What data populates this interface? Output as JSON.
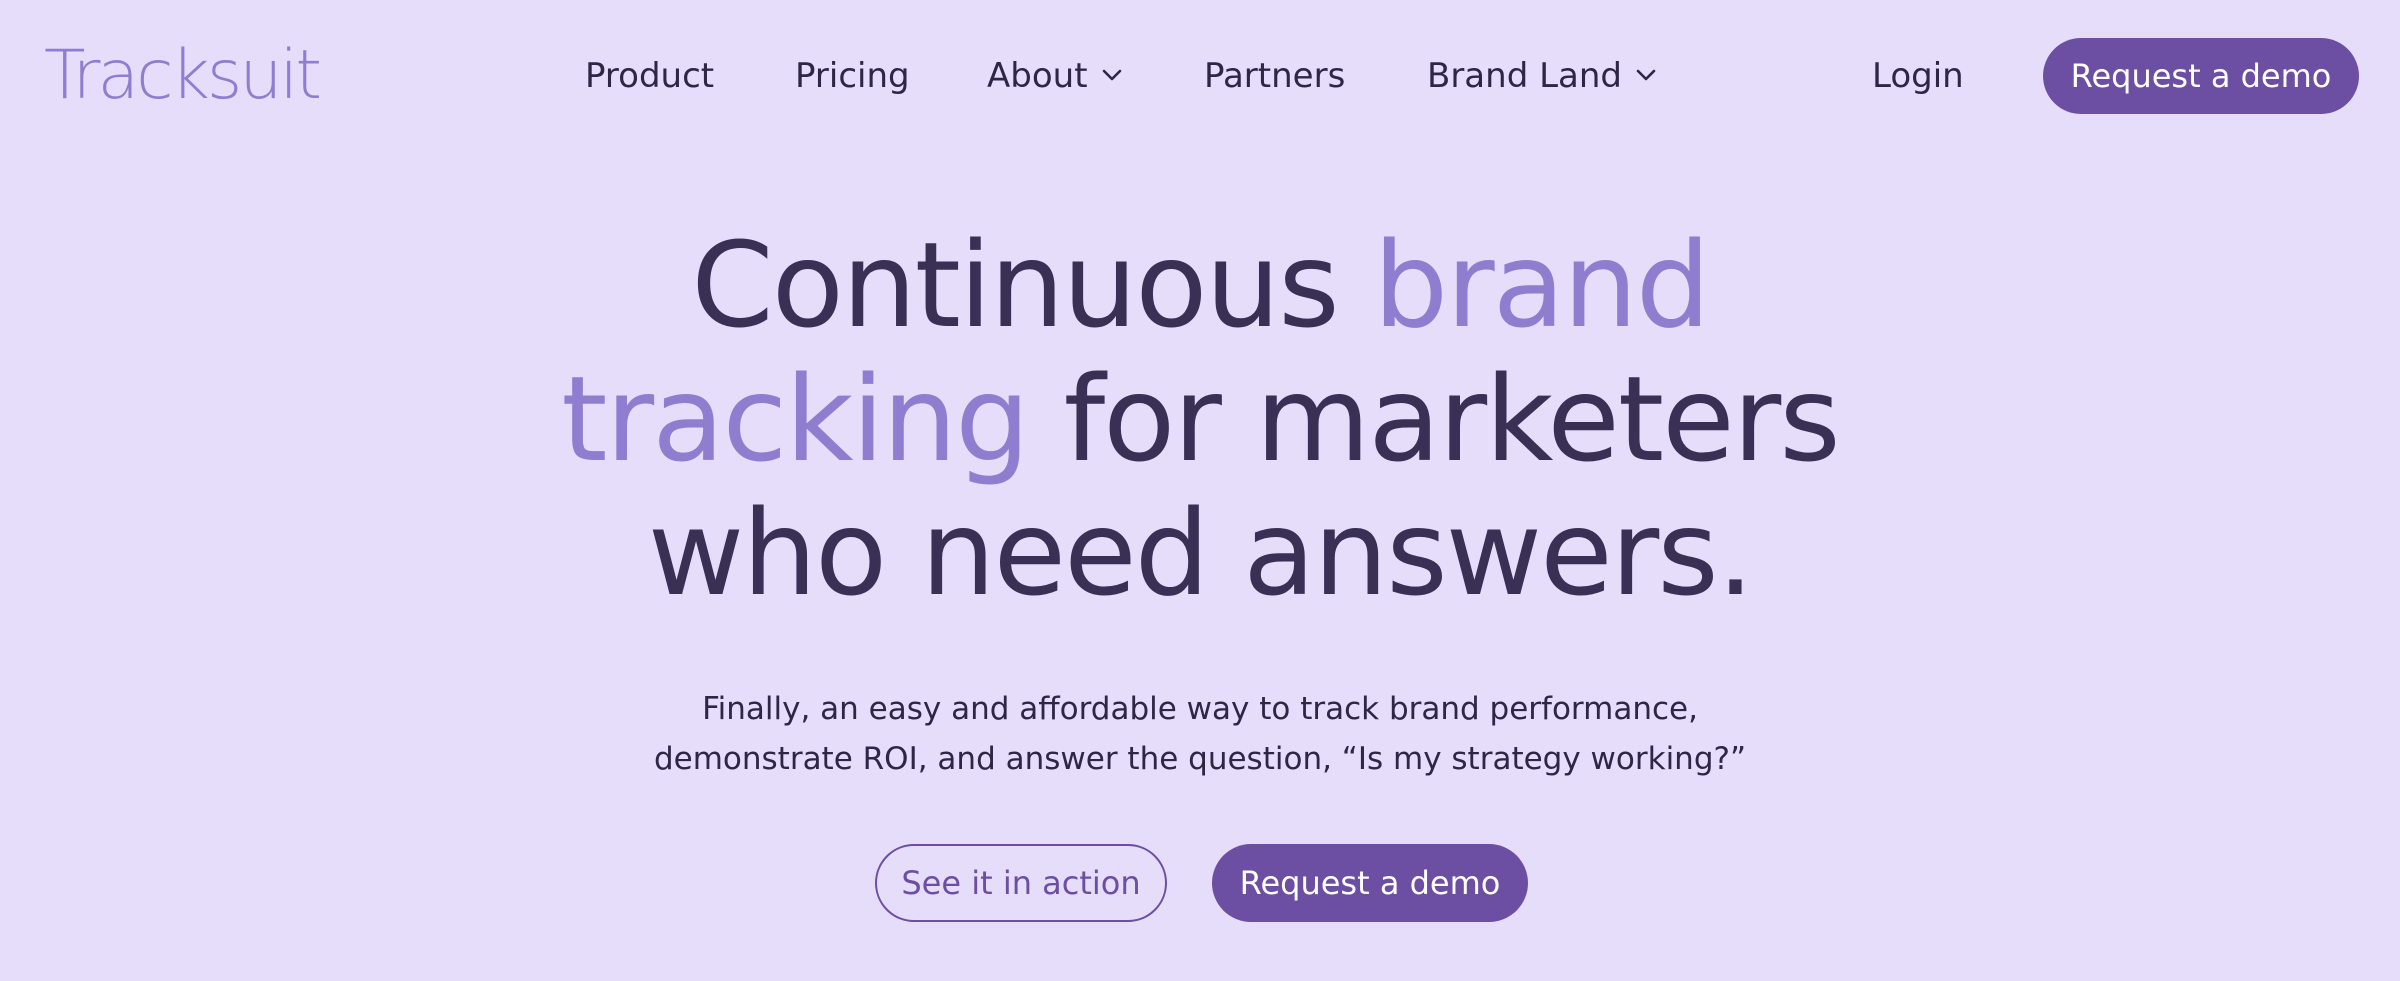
{
  "brand": {
    "logo_text": "Tracksuit"
  },
  "nav": {
    "items": [
      {
        "label": "Product",
        "has_dropdown": false
      },
      {
        "label": "Pricing",
        "has_dropdown": false
      },
      {
        "label": "About",
        "has_dropdown": true
      },
      {
        "label": "Partners",
        "has_dropdown": false
      },
      {
        "label": "Brand Land",
        "has_dropdown": true
      }
    ],
    "login_label": "Login",
    "cta_label": "Request a demo"
  },
  "hero": {
    "line1_a": "Continuous ",
    "line1_b": "brand",
    "line2_a": "tracking",
    "line2_b": " for marketers",
    "line3": "who need answers.",
    "subtitle_line1": "Finally, an easy and affordable way to track brand performance,",
    "subtitle_line2": "demonstrate ROI, and answer the question, “Is my strategy working?”",
    "secondary_button": "See it in action",
    "primary_button": "Request a demo"
  },
  "colors": {
    "background": "#e6ddfa",
    "accent": "#6c4fa2",
    "highlight": "#8f7dd0",
    "text": "#2e2645"
  }
}
